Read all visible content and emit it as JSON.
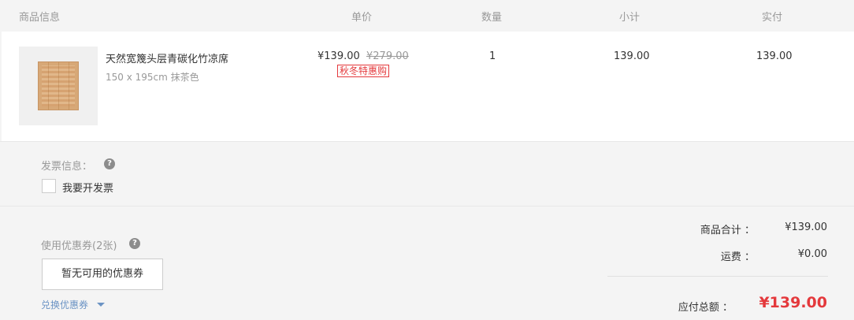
{
  "header": {
    "col_product": "商品信息",
    "col_unit_price": "单价",
    "col_quantity": "数量",
    "col_subtotal": "小计",
    "col_paid": "实付"
  },
  "item": {
    "name": "天然宽篾头层青碳化竹凉席",
    "spec": "150 x 195cm 抹茶色",
    "price": "¥139.00",
    "original_price": "¥279.00",
    "promo_tag": "秋冬特惠购",
    "quantity": "1",
    "subtotal": "139.00",
    "paid": "139.00"
  },
  "invoice": {
    "label": "发票信息：",
    "help": "?",
    "checkbox_label": "我要开发票"
  },
  "coupon": {
    "label": "使用优惠券(2张)",
    "help": "?",
    "button": "暂无可用的优惠券",
    "redeem": "兑换优惠券"
  },
  "summary": {
    "goods_total_label": "商品合计 ：",
    "goods_total": "¥139.00",
    "shipping_label": "运费 ：",
    "shipping": "¥0.00",
    "payable_label": "应付总额 ：",
    "payable": "¥139.00"
  },
  "colors": {
    "accent_red": "#e4393c",
    "link_blue": "#6b93c4"
  }
}
